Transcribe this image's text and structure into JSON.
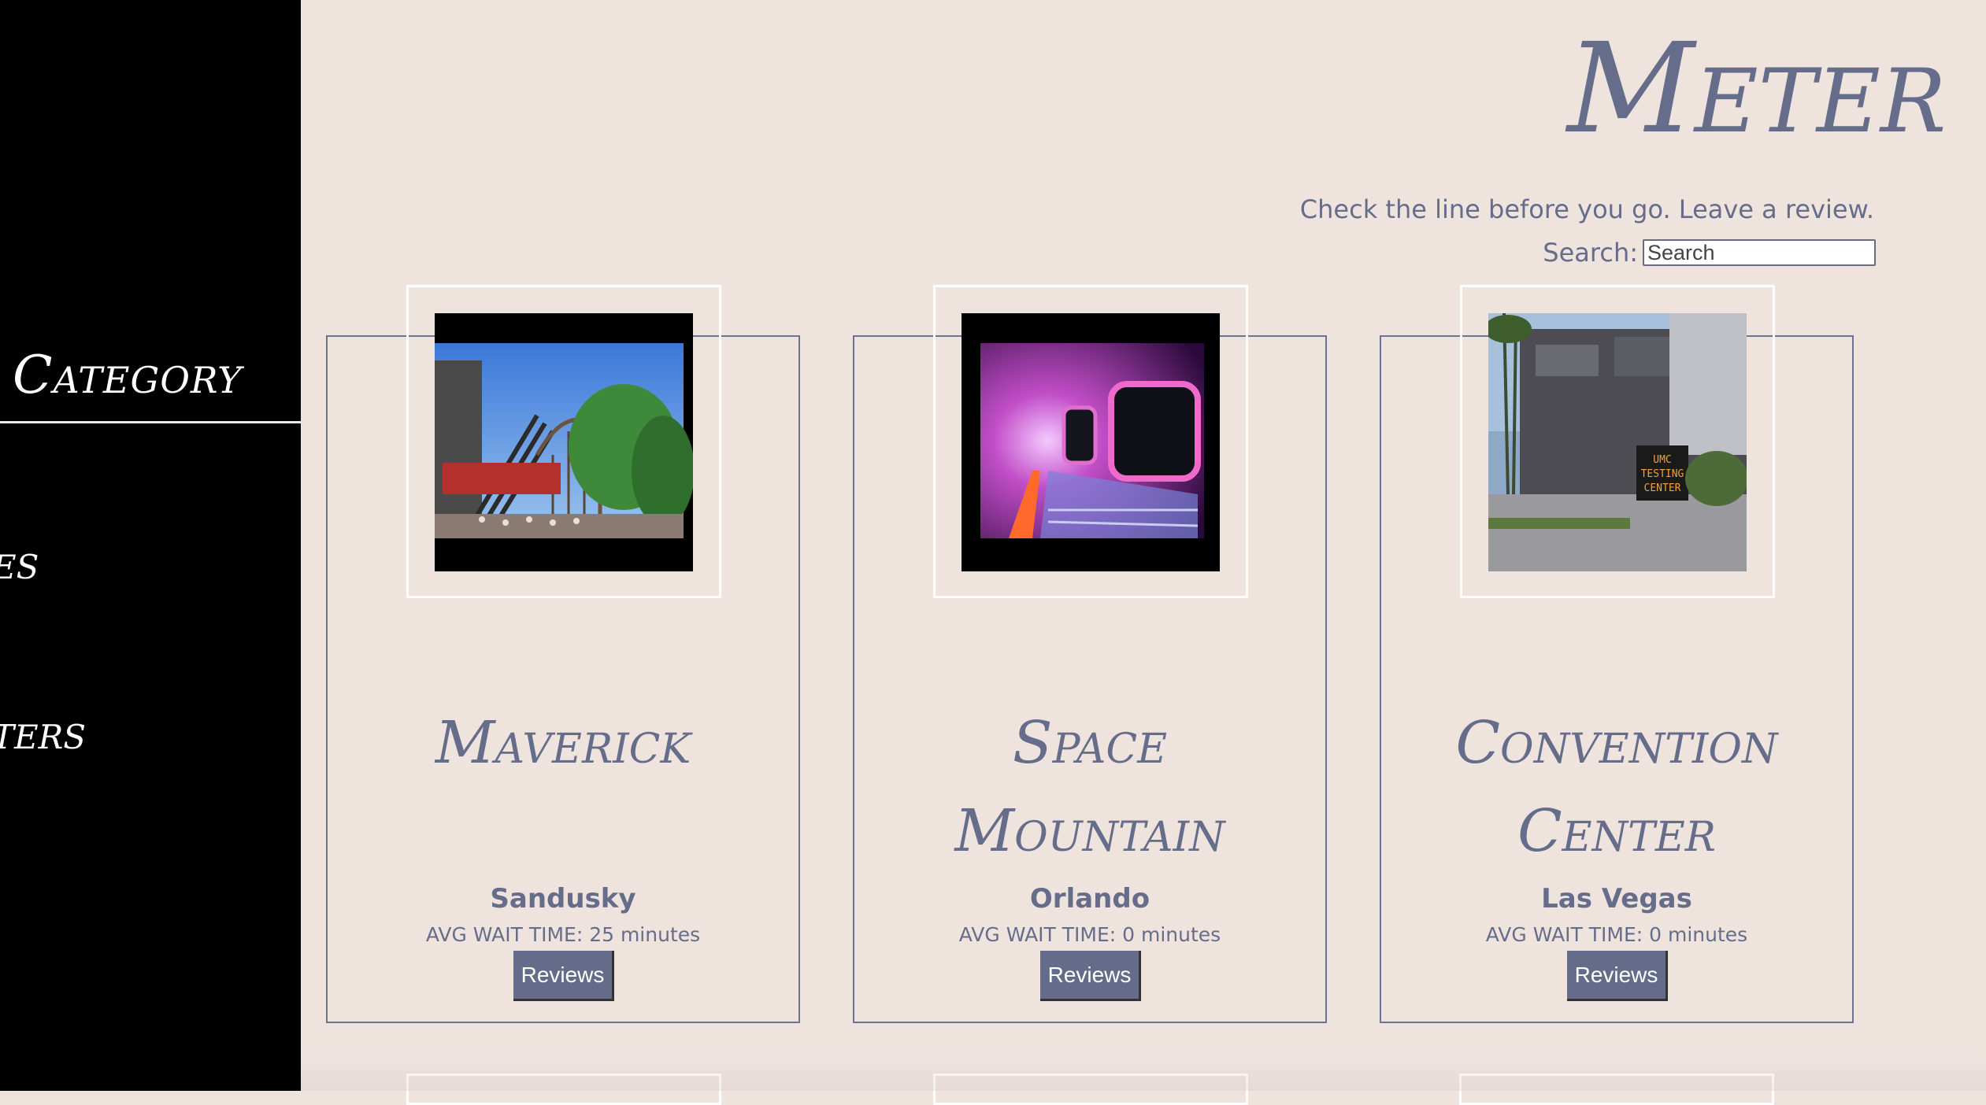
{
  "brand": "Meter",
  "tagline": "Check the line before you go. Leave a review.",
  "search": {
    "label": "Search:",
    "placeholder": "Search"
  },
  "sidebar": {
    "title": "Category",
    "items": [
      {
        "label": "es"
      },
      {
        "label": "ters"
      }
    ]
  },
  "cards": [
    {
      "title": "Maverick",
      "city": "Sandusky",
      "wait": "AVG WAIT TIME: 25 minutes",
      "button": "Reviews",
      "image": "roller-coaster-photo"
    },
    {
      "title": "Space Mountain",
      "city": "Orlando",
      "wait": "AVG WAIT TIME: 0 minutes",
      "button": "Reviews",
      "image": "space-tunnel-photo"
    },
    {
      "title": "Convention Center",
      "city": "Las Vegas",
      "wait": "AVG WAIT TIME: 0 minutes",
      "button": "Reviews",
      "image": "building-sign-photo"
    }
  ],
  "signs": {
    "umc": [
      "UMC",
      "TESTING",
      "CENTER"
    ]
  },
  "colors": {
    "background": "#efe3de",
    "accent": "#656d8a",
    "sidebar": "#000000",
    "button": "#646c89"
  }
}
